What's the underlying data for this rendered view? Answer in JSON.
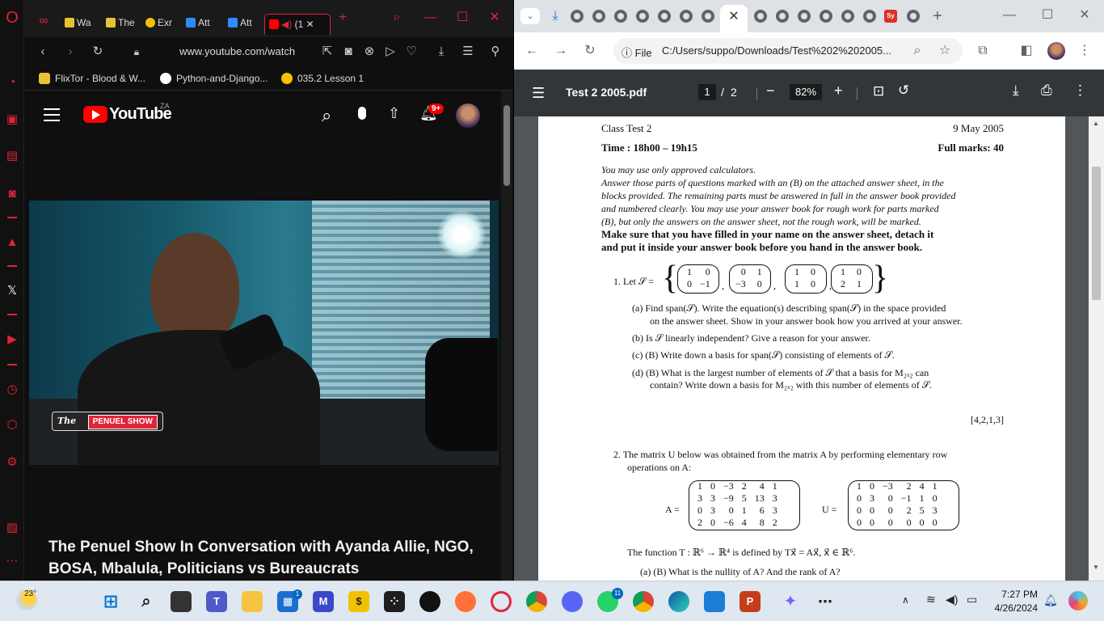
{
  "opera": {
    "tabs": [
      {
        "label": "Wa"
      },
      {
        "label": "The"
      },
      {
        "label": "Exr"
      },
      {
        "label": "Att"
      },
      {
        "label": "Att"
      },
      {
        "label": "(1"
      }
    ],
    "url": "www.youtube.com/watch",
    "bookmarks": [
      {
        "label": "FlixTor - Blood & W..."
      },
      {
        "label": "Python-and-Django..."
      },
      {
        "label": "035.2 Lesson 1"
      }
    ],
    "youtube": {
      "logo_text": "YouTube",
      "country": "ZA",
      "notif_count": "9+",
      "video_overlay": {
        "brand_prefix": "The",
        "brand": "PENUEL SHOW"
      },
      "video_title": "The Penuel Show In Conversation with Ayanda Allie, NGO, BOSA, Mbalula, Politicians vs Bureaucrats"
    }
  },
  "chrome": {
    "omnibox": {
      "scheme": "File",
      "url": "C:/Users/suppo/Downloads/Test%202%202005..."
    },
    "pdf": {
      "title": "Test 2 2005.pdf",
      "page_current": "1",
      "page_sep": "/",
      "page_total": "2",
      "zoom": "82%"
    }
  },
  "document": {
    "header_left": "Class Test 2",
    "header_right": "9 May 2005",
    "time": "Time : 18h00 – 19h15",
    "marks": "Full marks: 40",
    "instructions_italic": [
      "You may use only approved calculators.",
      "Answer those parts of questions marked with an (B) on the attached answer sheet, in the",
      "blocks provided.  The remaining parts must be answered in full in the answer book provided",
      "and numbered clearly.  You may use your answer book for rough work for parts marked",
      "(B), but only the answers on the answer sheet, not the rough work, will be marked."
    ],
    "instructions_bold": [
      "Make sure that you have filled in your name on the answer sheet, detach it",
      "and put it inside your answer book before you hand in the answer book."
    ],
    "q1_lead": "1.  Let 𝒮 =",
    "q1_matrices": [
      [
        [
          "1",
          "0"
        ],
        [
          "0",
          "−1"
        ]
      ],
      [
        [
          "0",
          "1"
        ],
        [
          "−3",
          "0"
        ]
      ],
      [
        [
          "1",
          "0"
        ],
        [
          "1",
          "0"
        ]
      ],
      [
        [
          "1",
          "0"
        ],
        [
          "2",
          "1"
        ]
      ]
    ],
    "q1_parts": [
      "(a)  Find span(𝒮).  Write the equation(s) describing span(𝒮) in the space provided",
      "on the answer sheet.  Show in your answer book how you arrived at your answer.",
      "(b)  Is 𝒮 linearly independent?  Give a reason for your answer.",
      "(c)  (B) Write down a basis for span(𝒮) consisting of elements of 𝒮.",
      "(d)  (B) What is the largest number of elements of 𝒮 that a basis for M₂ₓ₂ can",
      "contain?  Write down a basis for M₂ₓ₂ with this number of elements of 𝒮."
    ],
    "q1_marks": "[4,2,1,3]",
    "q2_lead": [
      "2.  The matrix U below was obtained from the matrix A by performing elementary row",
      "operations on A:"
    ],
    "matrix_A_label": "A =",
    "matrix_A": [
      [
        "1",
        "0",
        "−3",
        "2",
        "4",
        "1"
      ],
      [
        "3",
        "3",
        "−9",
        "5",
        "13",
        "3"
      ],
      [
        "0",
        "3",
        "0",
        "1",
        "6",
        "3"
      ],
      [
        "2",
        "0",
        "−6",
        "4",
        "8",
        "2"
      ]
    ],
    "matrix_U_label": "U =",
    "matrix_U": [
      [
        "1",
        "0",
        "−3",
        "2",
        "4",
        "1"
      ],
      [
        "0",
        "3",
        "0",
        "−1",
        "1",
        "0"
      ],
      [
        "0",
        "0",
        "0",
        "2",
        "5",
        "3"
      ],
      [
        "0",
        "0",
        "0",
        "0",
        "0",
        "0"
      ]
    ],
    "function_line": "The function T : ℝ⁶ → ℝ⁴ is defined by Tx⃗ = Ax⃗,   x⃗ ∈ ℝ⁶.",
    "cut_line": "(a)  (B) What is the nullity of A?  And the rank of A?"
  },
  "taskbar": {
    "weather_temp": "23°",
    "time": "7:27 PM",
    "date": "4/26/2024",
    "badges": {
      "widgets": "1",
      "whatsapp": "11"
    }
  },
  "colors": {
    "opera_accent": "#e0243a",
    "yt_red": "#ff0000",
    "pdf_toolbar": "#323639",
    "taskbar_bg": "#dfe7f0"
  }
}
